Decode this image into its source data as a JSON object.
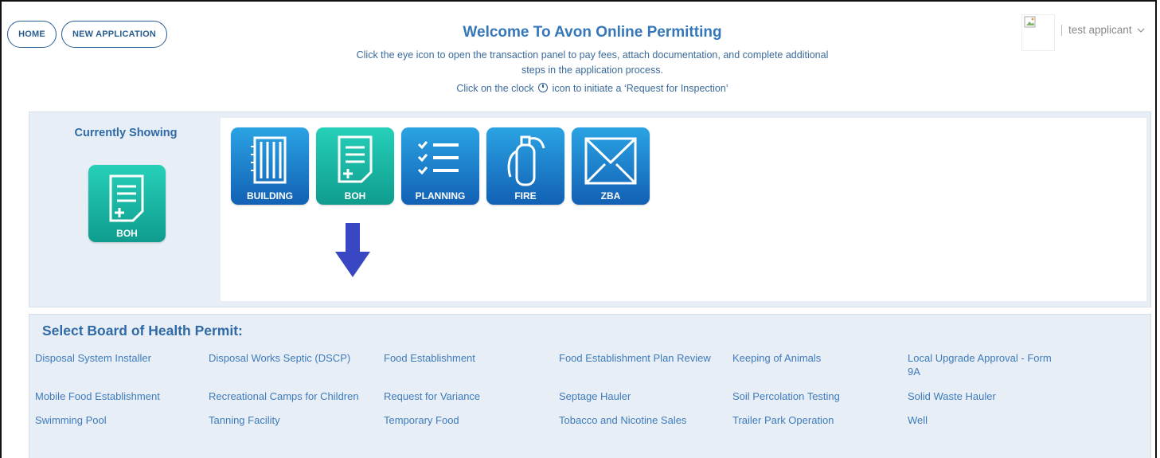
{
  "nav": {
    "home_label": "HOME",
    "new_application_label": "NEW APPLICATION"
  },
  "header": {
    "title": "Welcome To Avon Online Permitting",
    "subtitle_line1": "Click the eye icon to open the transaction panel to pay fees, attach documentation, and complete additional",
    "subtitle_line2": "steps in the application process.",
    "clock_pre": "Click on the clock",
    "clock_post": "icon to initiate a ‘Request for Inspection’"
  },
  "user": {
    "name": "test applicant",
    "avatar_icon": "broken-image-icon",
    "menu_icon": "chevron-down-icon"
  },
  "currently_showing": {
    "label": "Currently Showing",
    "selected_tile": "BOH"
  },
  "departments": [
    {
      "label": "BUILDING",
      "icon": "building-icon",
      "color": "blue"
    },
    {
      "label": "BOH",
      "icon": "document-plus-icon",
      "color": "teal"
    },
    {
      "label": "PLANNING",
      "icon": "checklist-icon",
      "color": "blue"
    },
    {
      "label": "FIRE",
      "icon": "fire-extinguisher-icon",
      "color": "blue"
    },
    {
      "label": "ZBA",
      "icon": "envelope-icon",
      "color": "blue"
    }
  ],
  "select_title": "Select Board of Health Permit:",
  "permits": [
    "Disposal System Installer",
    "Disposal Works Septic (DSCP)",
    "Food Establishment",
    "Food Establishment Plan Review",
    "Keeping of Animals",
    "Local Upgrade Approval - Form 9A",
    "Mobile Food Establishment",
    "Recreational Camps for Children",
    "Request for Variance",
    "Septage Hauler",
    "Soil Percolation Testing",
    "Solid Waste Hauler",
    "Swimming Pool",
    "Tanning Facility",
    "Temporary Food",
    "Tobacco and Nicotine Sales",
    "Trailer Park Operation",
    "Well"
  ],
  "colors": {
    "accent": "#3577b9",
    "link": "#3d7bbd",
    "arrow": "#3a47c2",
    "teal": "#17b3a3",
    "blue": "#1f7fcf"
  }
}
